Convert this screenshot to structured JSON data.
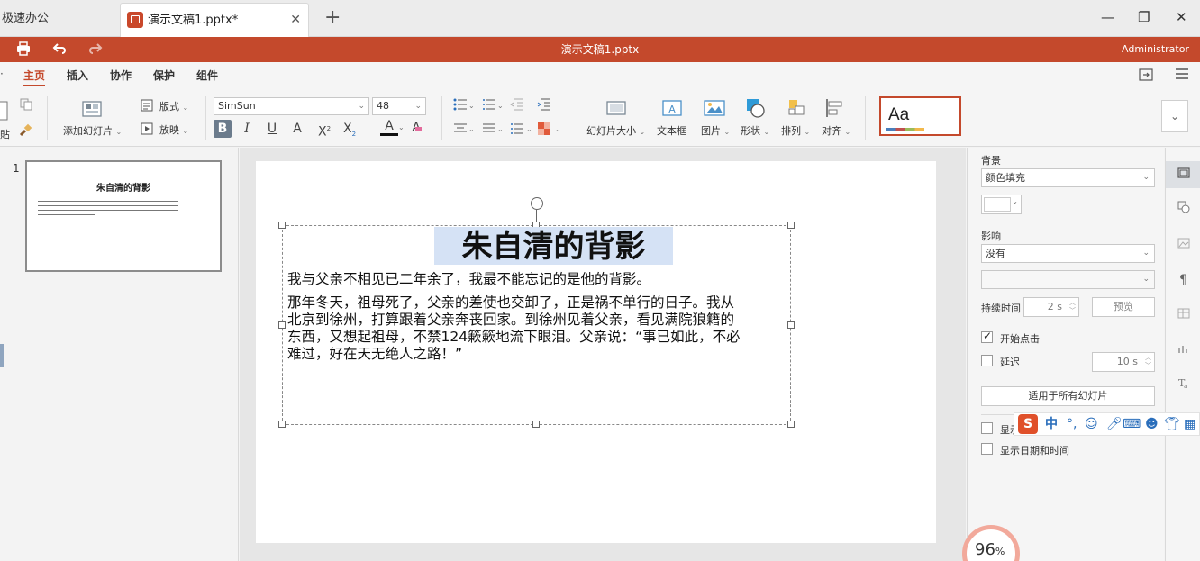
{
  "tabs": {
    "app_name": "极速办公",
    "doc_tab_label": "演示文稿1.pptx*",
    "close": "✕",
    "new": "+"
  },
  "window_controls": {
    "minimize": "—",
    "restore": "❐",
    "close": "✕"
  },
  "titlebar": {
    "doc_title": "演示文稿1.pptx",
    "user": "Administrator"
  },
  "menu": {
    "items": [
      "主页",
      "插入",
      "协作",
      "保护",
      "组件"
    ],
    "active": "主页"
  },
  "ribbon": {
    "add_slide": "添加幻灯片",
    "layout": "版式",
    "play": "放映",
    "font_name": "SimSun",
    "font_size": "48",
    "slide_size": "幻灯片大小",
    "text_box": "文本框",
    "picture": "图片",
    "shape": "形状",
    "arrange": "排列",
    "align": "对齐",
    "theme_preview": "Aa",
    "left_cut_label": "貼"
  },
  "slides_panel": {
    "slide_number": "1",
    "thumb_title": "朱自清的背影"
  },
  "slide": {
    "title": "朱自清的背影",
    "para1": "我与父亲不相见已二年余了，我最不能忘记的是他的背影。",
    "para2_line1": "那年冬天，祖母死了，父亲的差使也交卸了，正是祸不单行的日子。我从",
    "para2_line2": "北京到徐州，打算跟着父亲奔丧回家。到徐州见着父亲，看见满院狼籍的",
    "para2_line3": "东西，又想起祖母，不禁124簌簌地流下眼泪。父亲说：“事已如此，不必",
    "para2_line4": "难过，好在天无绝人之路！”"
  },
  "properties": {
    "background_label": "背景",
    "background_value": "颜色填充",
    "effect_label": "影响",
    "effect_value": "没有",
    "duration_label": "持续时间",
    "duration_value": "2 s",
    "preview_button": "预览",
    "start_on_click": "开始点击",
    "start_on_click_checked": true,
    "delay_label": "延迟",
    "delay_checked": false,
    "delay_value": "10 s",
    "apply_all_button": "适用于所有幻灯片",
    "show_label": "显示",
    "show_datetime": "显示日期和时间"
  },
  "ime": {
    "logo": "S",
    "mode": "中"
  },
  "zoom": {
    "value": "96",
    "unit": "%"
  },
  "colors": {
    "accent": "#c4492c",
    "selection": "#d5e2f5"
  }
}
